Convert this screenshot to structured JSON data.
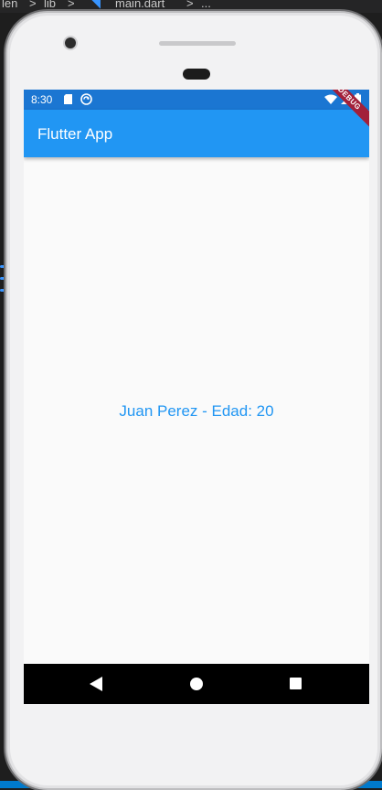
{
  "editor": {
    "crumb_1": "len",
    "crumb_sep_1": ">",
    "crumb_2": "lib",
    "crumb_sep_2": ">",
    "crumb_3": "main.dart",
    "crumb_sep_3": ">",
    "crumb_4": "..."
  },
  "status_bar": {
    "time": "8:30",
    "icons": [
      "sd-card-icon",
      "sync-icon",
      "wifi-icon",
      "signal-icon",
      "battery-icon"
    ]
  },
  "app_bar": {
    "title": "Flutter App"
  },
  "debug_banner": {
    "label": "DEBUG"
  },
  "body": {
    "text": "Juan Perez - Edad: 20"
  },
  "nav_bar": {
    "icons": [
      "back-icon",
      "home-icon",
      "recents-icon"
    ]
  },
  "colors": {
    "app_bar": "#2196f3",
    "status_bar": "#1b76d2",
    "body_text": "#2196f3",
    "background": "#fafafa",
    "nav_bar": "#000000",
    "debug_banner": "#a2203a"
  }
}
